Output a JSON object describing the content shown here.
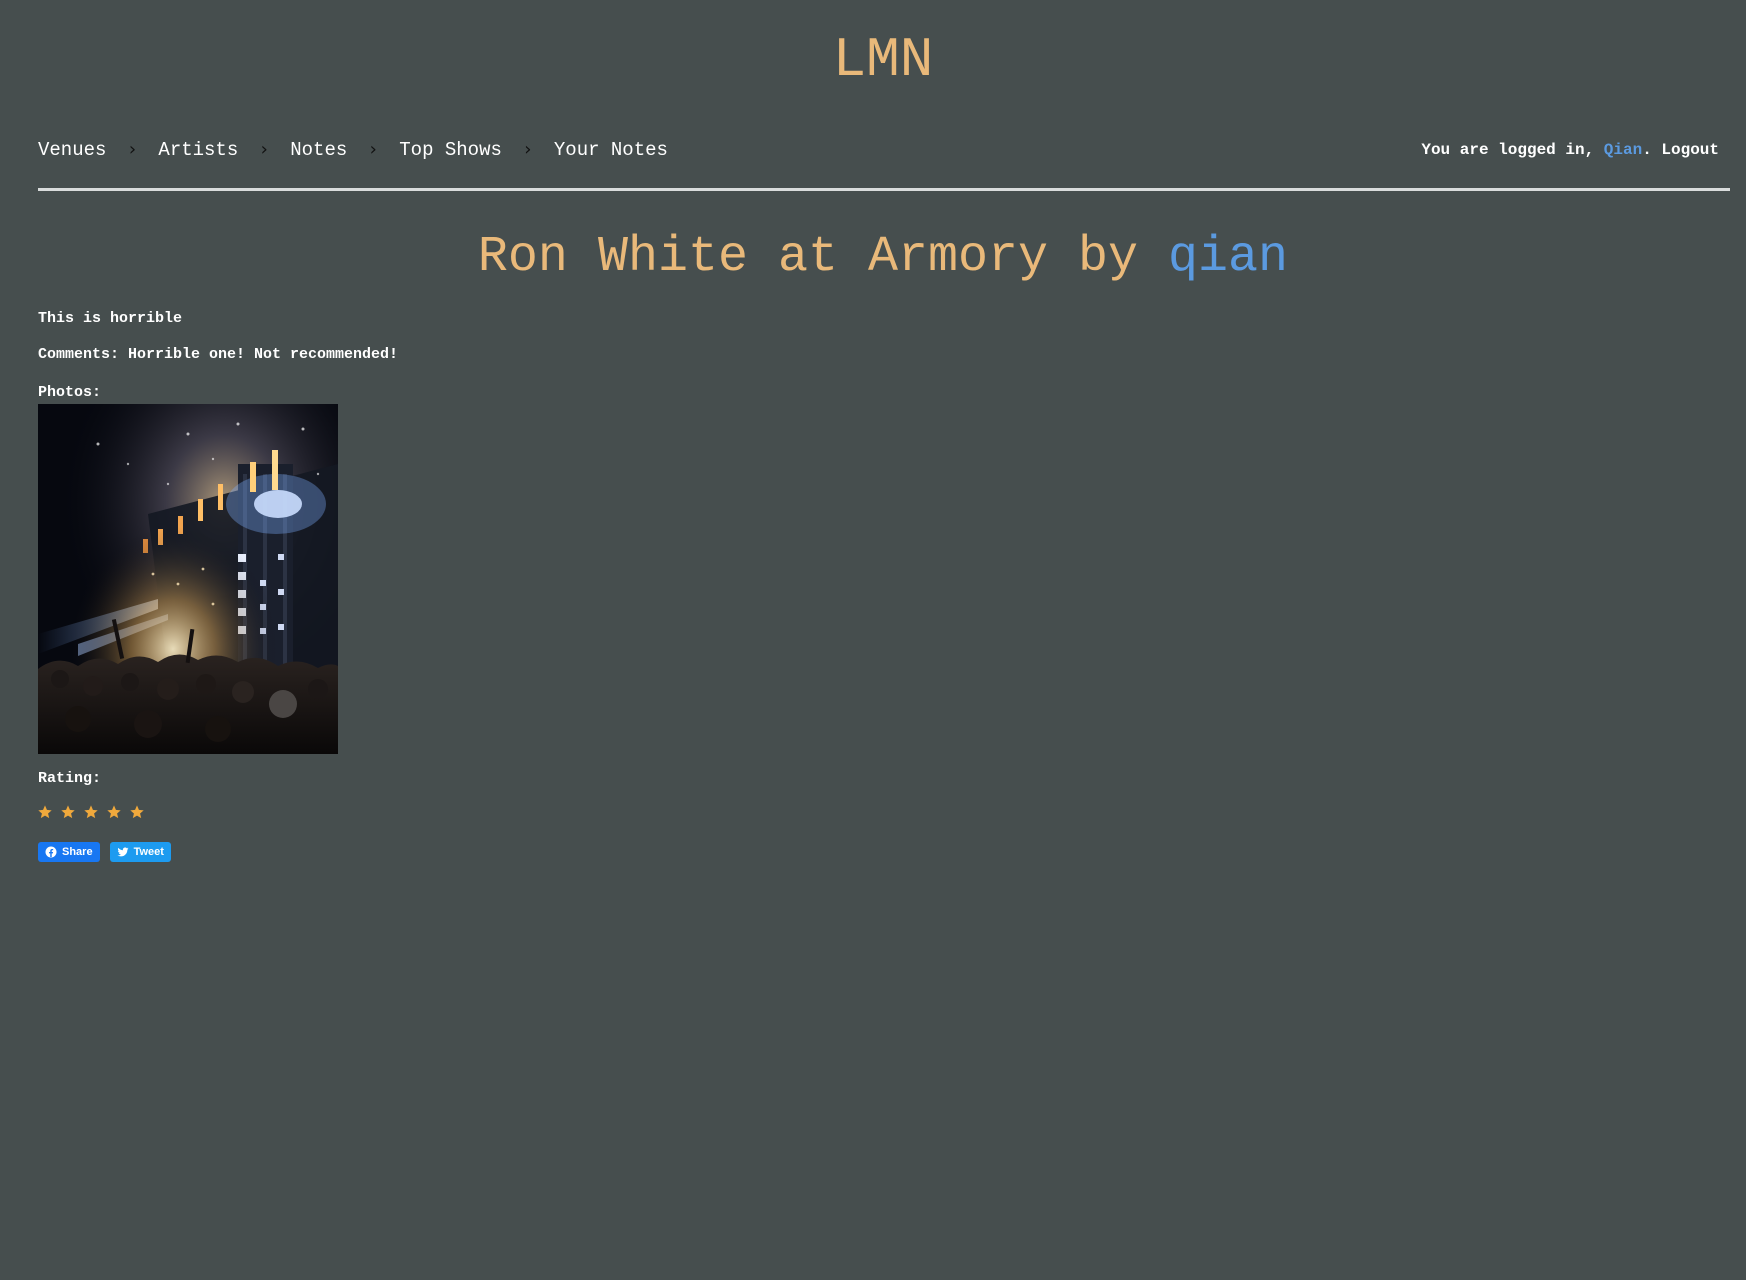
{
  "site": {
    "title": "LMN"
  },
  "nav": {
    "items": [
      {
        "label": "Venues"
      },
      {
        "label": "Artists"
      },
      {
        "label": "Notes"
      },
      {
        "label": "Top Shows"
      },
      {
        "label": "Your Notes"
      }
    ],
    "separator_icon": "chevron-right-icon"
  },
  "auth": {
    "prefix": "You are logged in, ",
    "username": "Qian",
    "suffix": ". ",
    "logout_label": "Logout"
  },
  "note": {
    "title_prefix": "Ron White at Armory by ",
    "title_user": "qian",
    "headline": "This is horrible",
    "comments": "Comments: Horrible one! Not recommended!",
    "photos_label": "Photos:",
    "photo_alt": "concert-crowd-photo",
    "rating_label": "Rating:",
    "rating_value": 5,
    "rating_max": 5
  },
  "share": {
    "facebook_label": "Share",
    "twitter_label": "Tweet"
  },
  "colors": {
    "background": "#464e4e",
    "accent": "#e9b97a",
    "link": "#5b9ae0",
    "star": "#f0a93c",
    "facebook": "#1877f2",
    "twitter": "#1d9bf0"
  }
}
